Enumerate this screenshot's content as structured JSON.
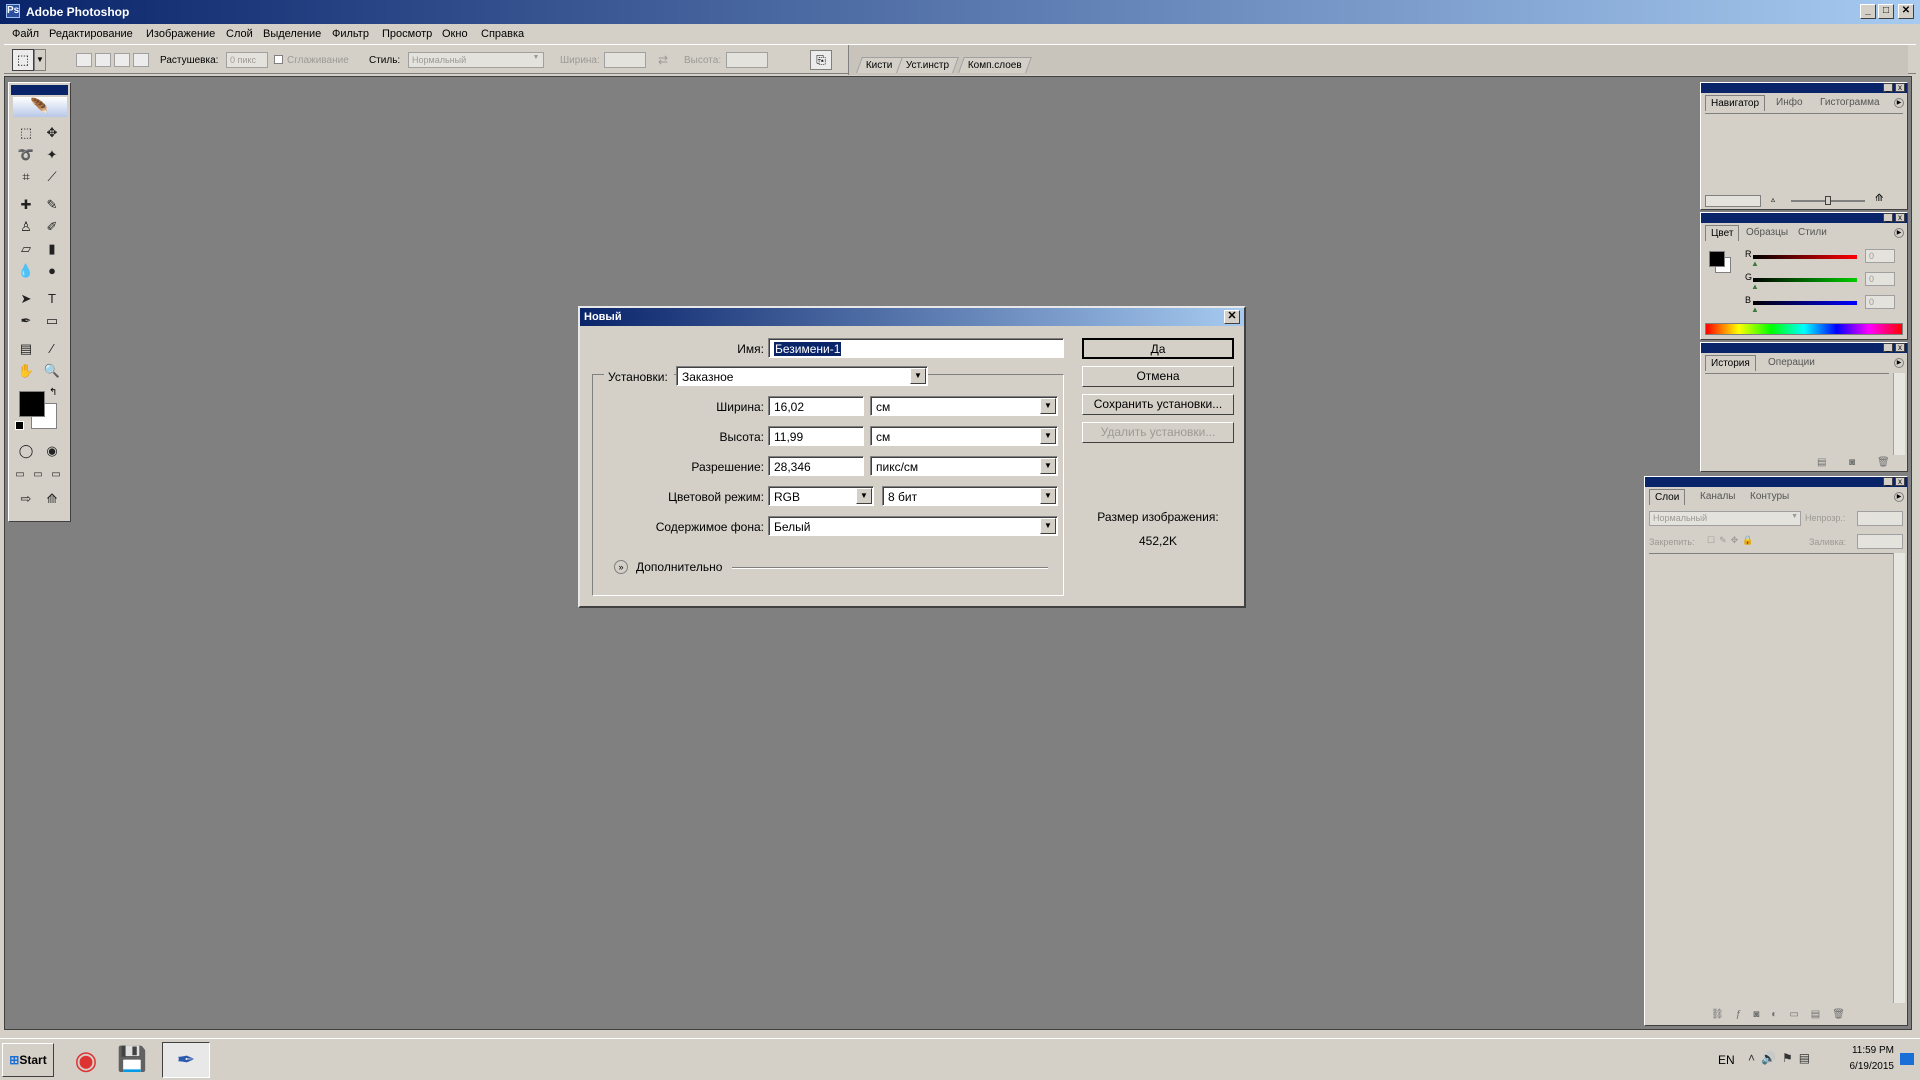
{
  "app": {
    "title": "Adobe Photoshop"
  },
  "window_controls": {
    "minimize": "_",
    "maximize": "□",
    "close": "✕"
  },
  "menu": [
    "Файл",
    "Редактирование",
    "Изображение",
    "Слой",
    "Выделение",
    "Фильтр",
    "Просмотр",
    "Окно",
    "Справка"
  ],
  "options_bar": {
    "feather_label": "Растушевка:",
    "feather_value": "0 пикс",
    "antialias_label": "Сглаживание",
    "style_label": "Стиль:",
    "style_value": "Нормальный",
    "width_label": "Ширина:",
    "height_label": "Высота:",
    "palette_tabs": [
      "Кисти",
      "Уст.инстр",
      "Комп.слоев"
    ]
  },
  "dialog": {
    "title": "Новый",
    "name_label": "Имя:",
    "name_value": "Безимени-1",
    "preset_label": "Установки:",
    "preset_value": "Заказное",
    "width_label": "Ширина:",
    "width_value": "16,02",
    "width_unit": "см",
    "height_label": "Высота:",
    "height_value": "11,99",
    "height_unit": "см",
    "resolution_label": "Разрешение:",
    "resolution_value": "28,346",
    "resolution_unit": "пикс/см",
    "color_mode_label": "Цветовой режим:",
    "color_mode_value": "RGB",
    "bit_depth_value": "8 бит",
    "background_label": "Содержимое фона:",
    "background_value": "Белый",
    "advanced_label": "Дополнительно",
    "ok_label": "Да",
    "cancel_label": "Отмена",
    "save_preset_label": "Сохранить установки...",
    "delete_preset_label": "Удалить установки...",
    "image_size_label": "Размер изображения:",
    "image_size_value": "452,2K"
  },
  "navigator_panel": {
    "tabs": [
      "Навигатор",
      "Инфо",
      "Гистограмма"
    ]
  },
  "color_panel": {
    "tabs": [
      "Цвет",
      "Образцы",
      "Стили"
    ],
    "r_label": "R",
    "g_label": "G",
    "b_label": "B",
    "r_value": "0",
    "g_value": "0",
    "b_value": "0"
  },
  "history_panel": {
    "tabs": [
      "История",
      "Операции"
    ]
  },
  "layers_panel": {
    "tabs": [
      "Слои",
      "Каналы",
      "Контуры"
    ],
    "blend_mode": "Нормальный",
    "opacity_label": "Непрозр.:",
    "lock_label": "Закрепить:",
    "fill_label": "Заливка:"
  },
  "taskbar": {
    "start_label": "Start",
    "lang": "EN",
    "time": "11:59 PM",
    "date": "6/19/2015"
  }
}
